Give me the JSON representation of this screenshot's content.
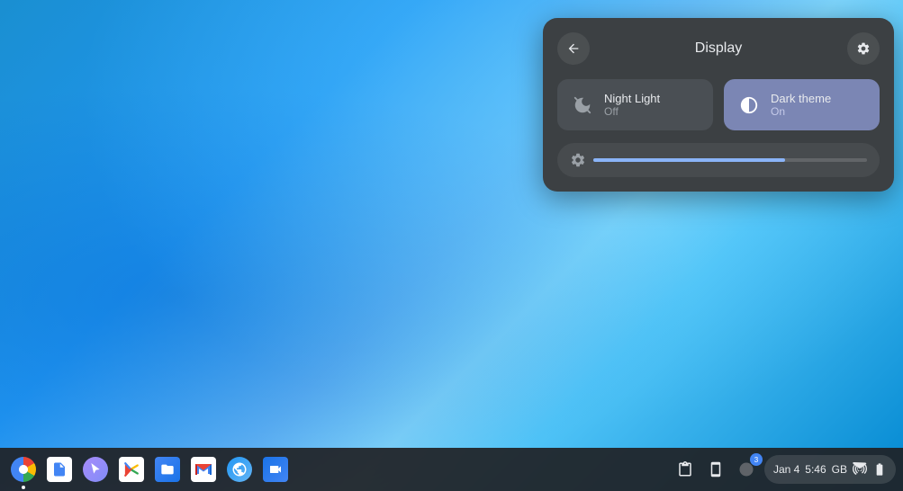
{
  "desktop": {
    "background_description": "Blue gradient wallpaper"
  },
  "panel": {
    "title": "Display",
    "back_label": "←",
    "settings_label": "⚙"
  },
  "night_light_card": {
    "label": "Night Light",
    "status": "Off",
    "state": "off",
    "icon": "night-light-off-icon"
  },
  "dark_theme_card": {
    "label": "Dark theme",
    "status": "On",
    "state": "on",
    "icon": "dark-theme-icon"
  },
  "brightness": {
    "icon": "brightness-icon",
    "value": 70
  },
  "taskbar": {
    "apps": [
      {
        "name": "Chrome",
        "icon": "chrome-icon",
        "active": true
      },
      {
        "name": "Docs",
        "icon": "docs-icon",
        "active": false
      },
      {
        "name": "Cursor",
        "icon": "cursor-icon",
        "active": false
      },
      {
        "name": "Play Store",
        "icon": "play-icon",
        "active": false
      },
      {
        "name": "Files",
        "icon": "files-icon",
        "active": false
      },
      {
        "name": "Gmail",
        "icon": "gmail-icon",
        "active": false
      },
      {
        "name": "Safari",
        "icon": "safari-icon",
        "active": false
      },
      {
        "name": "Duo",
        "icon": "duo-icon",
        "active": false
      }
    ],
    "status_icons": [
      {
        "name": "clipboard-icon",
        "symbol": "⧉"
      },
      {
        "name": "phone-icon",
        "symbol": "📱"
      },
      {
        "name": "mic-icon",
        "symbol": "🔵"
      }
    ],
    "notification_count": "3",
    "date": "Jan 4",
    "time": "5:46",
    "storage": "GB",
    "wifi_icon": "wifi-icon",
    "battery_icon": "battery-icon"
  }
}
